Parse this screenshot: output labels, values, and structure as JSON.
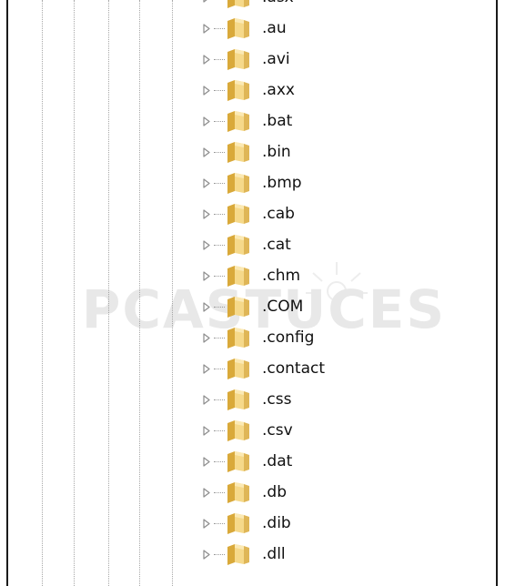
{
  "registry_tree": {
    "items": [
      {
        "label": ".asx"
      },
      {
        "label": ".au"
      },
      {
        "label": ".avi"
      },
      {
        "label": ".axx"
      },
      {
        "label": ".bat"
      },
      {
        "label": ".bin"
      },
      {
        "label": ".bmp"
      },
      {
        "label": ".cab"
      },
      {
        "label": ".cat"
      },
      {
        "label": ".chm"
      },
      {
        "label": ".COM"
      },
      {
        "label": ".config"
      },
      {
        "label": ".contact"
      },
      {
        "label": ".css"
      },
      {
        "label": ".csv"
      },
      {
        "label": ".dat"
      },
      {
        "label": ".db"
      },
      {
        "label": ".dib"
      },
      {
        "label": ".dll"
      }
    ]
  },
  "watermark": {
    "text": "PCASTUCES"
  },
  "icons": {
    "expander": "collapsed-arrow-icon",
    "node": "folder-icon"
  },
  "colors": {
    "folder_light": "#f6d98a",
    "folder_dark": "#d9a93a",
    "arrow": "#8c8c8c"
  }
}
